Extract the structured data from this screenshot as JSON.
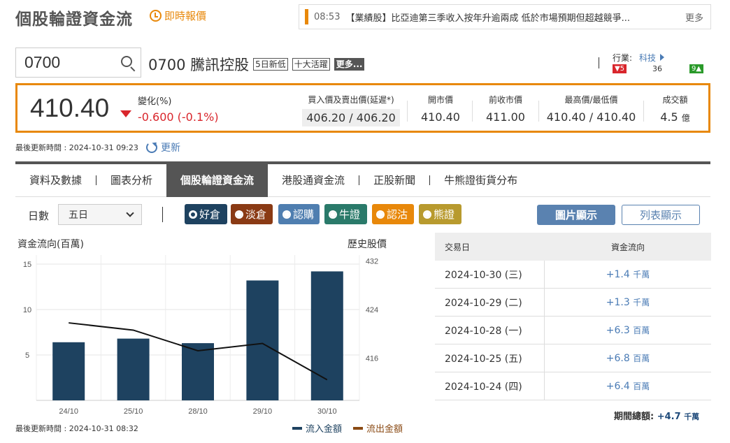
{
  "header": {
    "title": "個股輪證資金流",
    "realtime_label": "即時報價"
  },
  "ticker": {
    "time": "08:53",
    "headline": "【業績股】比亞迪第三季收入按年升逾兩成 低於市場預期但超越競爭...",
    "more": "更多"
  },
  "search": {
    "value": "0700"
  },
  "stock": {
    "code_name": "0700 騰訊控股",
    "tags": [
      "5日新低",
      "十大活躍"
    ],
    "more_tag": "更多..."
  },
  "industry": {
    "label": "行業:",
    "sector": "科技",
    "down_count": "5",
    "neutral_count": "36",
    "up_count": "9"
  },
  "quote": {
    "price": "410.40",
    "change_label": "變化(%)",
    "change_value": "-0.600 (-0.1%)",
    "bidask_label": "買入價及賣出價(延遲*)",
    "bidask_value": "406.20 / 406.20",
    "open_label": "開市價",
    "open_value": "410.40",
    "prev_close_label": "前收市價",
    "prev_close_value": "411.00",
    "high_low_label": "最高價/最低價",
    "high_low_value": "410.40 / 410.40",
    "turnover_label": "成交額",
    "turnover_value": "4.5",
    "turnover_unit": "億"
  },
  "last_updated": "最後更新時間 : 2024-10-31 09:23",
  "refresh_label": "更新",
  "tabs": [
    "資料及數據",
    "圖表分析",
    "個股輪證資金流",
    "港股通資金流",
    "正股新聞",
    "牛熊證街貨分布"
  ],
  "active_tab": 2,
  "filters": {
    "days_label": "日數",
    "days_value": "五日",
    "chips": [
      {
        "label": "好倉",
        "color": "#1e4260",
        "selected": true
      },
      {
        "label": "淡倉",
        "color": "#8a3a14",
        "selected": false
      },
      {
        "label": "認購",
        "color": "#4f7eb0",
        "selected": false
      },
      {
        "label": "牛證",
        "color": "#2a7a6a",
        "selected": false
      },
      {
        "label": "認沽",
        "color": "#e8880a",
        "selected": false
      },
      {
        "label": "熊證",
        "color": "#b89a2e",
        "selected": false
      }
    ],
    "chart_button": "圖片顯示",
    "list_button": "列表顯示"
  },
  "chart_data": {
    "type": "bar",
    "ylabel": "資金流向(百萬)",
    "y2label": "歷史股價",
    "categories": [
      "24/10",
      "25/10",
      "28/10",
      "29/10",
      "30/10"
    ],
    "series": [
      {
        "name": "流入金額",
        "type": "bar",
        "color": "#1e4260",
        "values": [
          6.4,
          6.8,
          6.3,
          13.2,
          14.2
        ]
      },
      {
        "name": "流出金額",
        "type": "bar",
        "color": "#8a4a14",
        "values": [
          0,
          0,
          0,
          0,
          0
        ]
      },
      {
        "name": "歷史股價",
        "type": "line",
        "color": "#111111",
        "axis": "right",
        "values": [
          421.8,
          420.6,
          417.2,
          418.4,
          412.4
        ]
      }
    ],
    "ylim": [
      0,
      16
    ],
    "yticks": [
      5,
      10,
      15
    ],
    "y2lim": [
      409,
      433
    ],
    "y2ticks": [
      416,
      424,
      432
    ],
    "grid": true
  },
  "chart_updated": "最後更新時間 : 2024-10-31 08:32",
  "table": {
    "headers": [
      "交易日",
      "資金流向"
    ],
    "rows": [
      {
        "date": "2024-10-30 (三)",
        "value": "+1.4",
        "unit": "千萬"
      },
      {
        "date": "2024-10-29 (二)",
        "value": "+1.3",
        "unit": "千萬"
      },
      {
        "date": "2024-10-28 (一)",
        "value": "+6.3",
        "unit": "百萬"
      },
      {
        "date": "2024-10-25 (五)",
        "value": "+6.8",
        "unit": "百萬"
      },
      {
        "date": "2024-10-24 (四)",
        "value": "+6.4",
        "unit": "百萬"
      }
    ],
    "total_label": "期間總額:",
    "total_value": "+4.7",
    "total_unit": "千萬"
  }
}
